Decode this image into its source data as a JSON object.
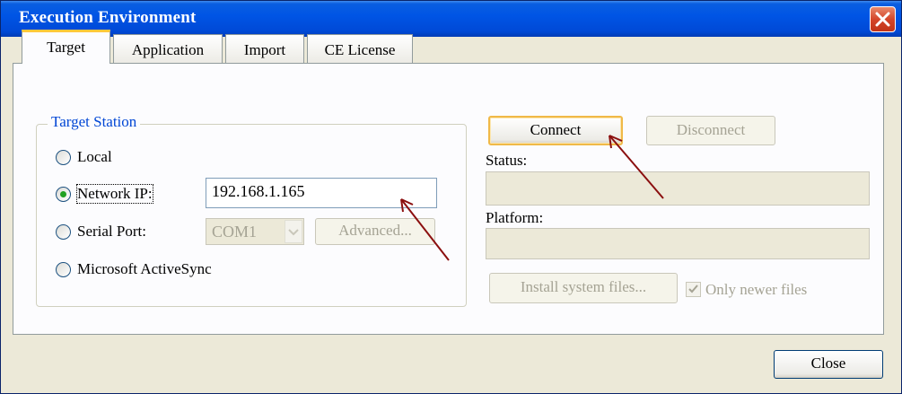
{
  "window": {
    "title": "Execution Environment"
  },
  "tabs": [
    {
      "label": "Target"
    },
    {
      "label": "Application"
    },
    {
      "label": "Import"
    },
    {
      "label": "CE License"
    }
  ],
  "target_station": {
    "group_label": "Target Station",
    "local_label": "Local",
    "network_ip_label": "Network IP:",
    "network_ip_value": "192.168.1.165",
    "network_ip_selected": true,
    "serial_port_label": "Serial Port:",
    "serial_port_value": "COM1",
    "advanced_label": "Advanced...",
    "activesync_label": "Microsoft ActiveSync"
  },
  "connection": {
    "connect_label": "Connect",
    "disconnect_label": "Disconnect",
    "status_label": "Status:",
    "status_value": "",
    "platform_label": "Platform:",
    "platform_value": "",
    "install_label": "Install system files...",
    "only_newer_label": "Only newer files",
    "only_newer_checked": true
  },
  "footer": {
    "close_label": "Close"
  },
  "colors": {
    "titlebar": "#0055e5",
    "annotation_arrow": "#8b0f0f",
    "group_label": "#0046d5"
  }
}
